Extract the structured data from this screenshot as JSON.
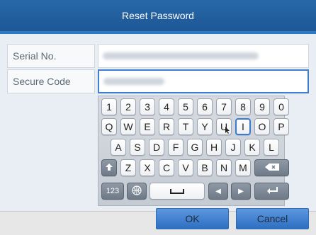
{
  "dialog": {
    "title": "Reset Password"
  },
  "fields": {
    "serial": {
      "label": "Serial No."
    },
    "secure": {
      "label": "Secure Code"
    }
  },
  "keyboard": {
    "rows": [
      [
        "1",
        "2",
        "3",
        "4",
        "5",
        "6",
        "7",
        "8",
        "9",
        "0"
      ],
      [
        "Q",
        "W",
        "E",
        "R",
        "T",
        "Y",
        "U",
        "I",
        "O",
        "P"
      ],
      [
        "A",
        "S",
        "D",
        "F",
        "G",
        "H",
        "J",
        "K",
        "L"
      ],
      [
        "Z",
        "X",
        "C",
        "V",
        "B",
        "N",
        "M"
      ]
    ],
    "special": {
      "num_toggle": "123",
      "globe": "globe-icon",
      "space": "space",
      "left": "◀",
      "right": "▶"
    }
  },
  "buttons": {
    "ok": "OK",
    "cancel": "Cancel"
  }
}
